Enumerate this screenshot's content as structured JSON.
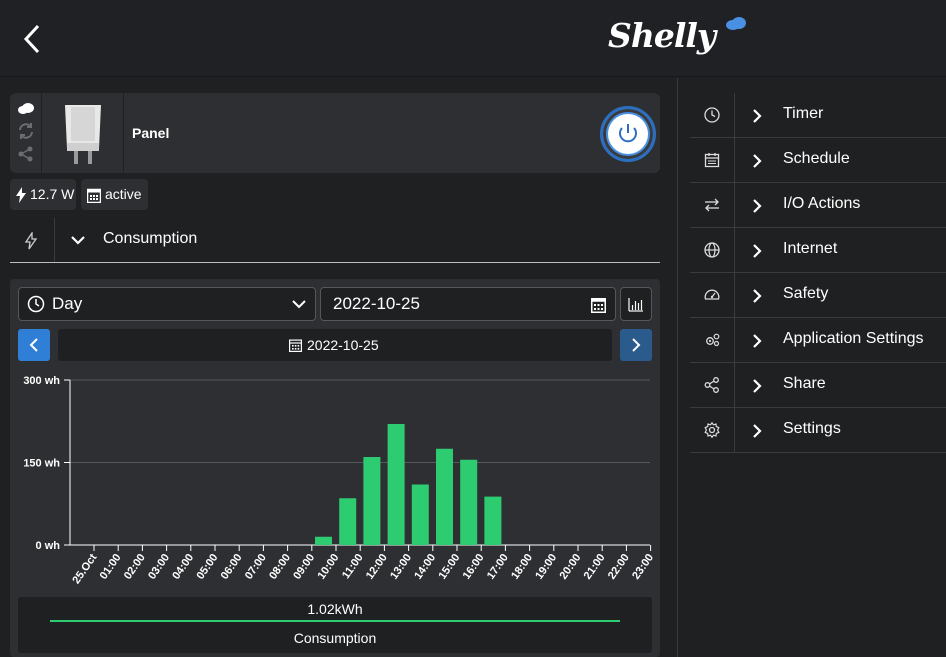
{
  "brand": {
    "logo_text": "Shelly"
  },
  "device": {
    "name": "Panel",
    "power_on": true
  },
  "status": {
    "power": "12.7 W",
    "state": "active"
  },
  "section": {
    "title": "Consumption"
  },
  "controls": {
    "period": "Day",
    "date_input": "2022-10-25",
    "date_label": "2022-10-25"
  },
  "summary": {
    "total": "1.02kWh",
    "label": "Consumption"
  },
  "colors": {
    "accent": "#4a90e2",
    "bar": "#2ecc71",
    "nav_button": "#2f7fd6"
  },
  "menu": [
    {
      "label": "Timer",
      "icon": "clock-icon"
    },
    {
      "label": "Schedule",
      "icon": "calendar-icon"
    },
    {
      "label": "I/O Actions",
      "icon": "arrows-icon"
    },
    {
      "label": "Internet",
      "icon": "globe-icon"
    },
    {
      "label": "Safety",
      "icon": "gauge-icon"
    },
    {
      "label": "Application Settings",
      "icon": "gears-icon"
    },
    {
      "label": "Share",
      "icon": "share-icon"
    },
    {
      "label": "Settings",
      "icon": "gear-icon"
    }
  ],
  "chart_data": {
    "type": "bar",
    "categories": [
      "25.Oct",
      "01:00",
      "02:00",
      "03:00",
      "04:00",
      "05:00",
      "06:00",
      "07:00",
      "08:00",
      "09:00",
      "10:00",
      "11:00",
      "12:00",
      "13:00",
      "14:00",
      "15:00",
      "16:00",
      "17:00",
      "18:00",
      "19:00",
      "20:00",
      "21:00",
      "22:00",
      "23:00"
    ],
    "values": [
      0,
      0,
      0,
      0,
      0,
      0,
      0,
      0,
      0,
      0,
      15,
      85,
      160,
      220,
      110,
      175,
      155,
      88,
      0,
      0,
      0,
      0,
      0,
      0
    ],
    "ylim": [
      0,
      300
    ],
    "yticks": [
      {
        "value": 300,
        "label": "300 wh"
      },
      {
        "value": 150,
        "label": "150 wh"
      },
      {
        "value": 0,
        "label": "0 wh"
      }
    ],
    "grid": true
  }
}
